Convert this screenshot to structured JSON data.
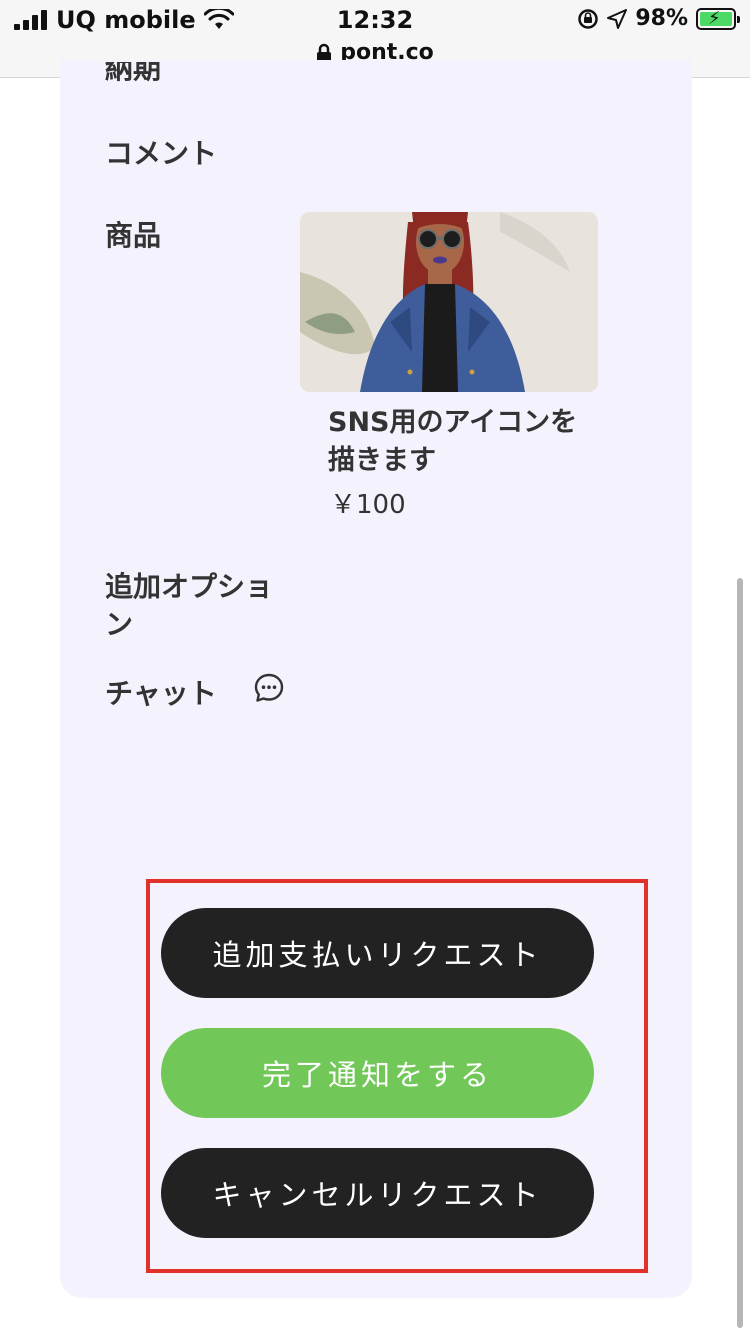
{
  "status_bar": {
    "carrier": "UQ mobile",
    "time": "12:32",
    "url": "pont.co",
    "battery": "98%"
  },
  "order_details": {
    "partial_label": "納期",
    "comment_label": "コメント",
    "product_label": "商品",
    "product": {
      "title": "SNS用のアイコンを描きます",
      "price": "￥100"
    },
    "options_label": "追加オプション",
    "chat_label": "チャット"
  },
  "actions": {
    "additional_payment": "追加支払いリクエスト",
    "complete_notice": "完了通知をする",
    "cancel_request": "キャンセルリクエスト"
  },
  "colors": {
    "card_background": "#f4f2fc",
    "dark_button": "#222222",
    "green_button": "#71c758",
    "highlight_border": "#e0322b"
  },
  "icons": [
    "signal-icon",
    "wifi-icon",
    "lock-icon",
    "orientation-lock-icon",
    "location-icon",
    "battery-icon",
    "chat-icon"
  ]
}
